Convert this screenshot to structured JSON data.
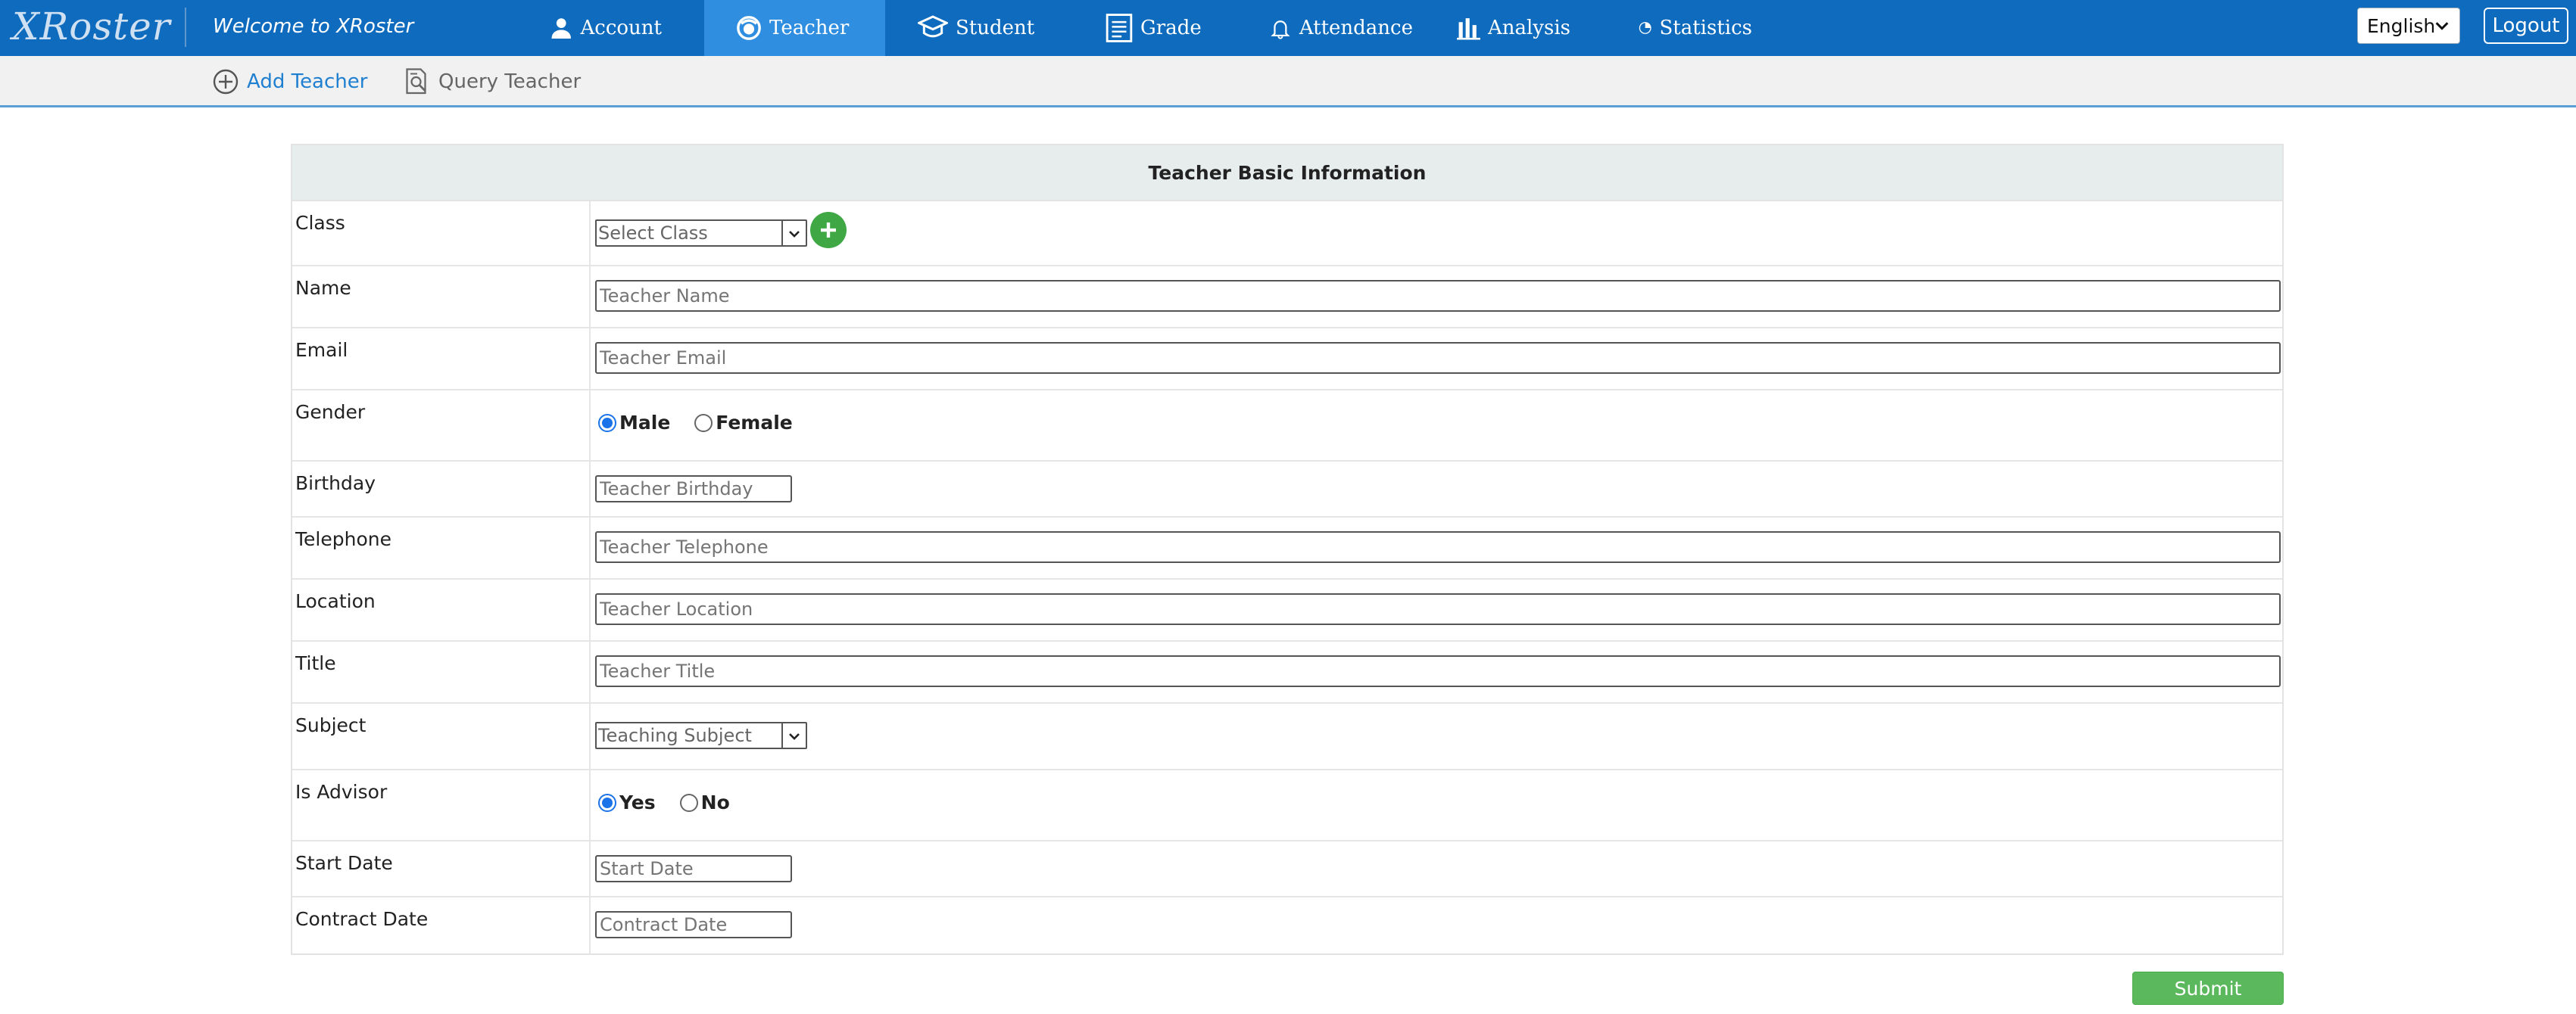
{
  "app": {
    "logo_text": "XRoster",
    "welcome_text": "Welcome to XRoster",
    "brand_color": "#0e6bbd",
    "active_color": "#2f8ee0"
  },
  "nav": {
    "items": [
      {
        "label": "Account",
        "icon": "user-icon",
        "active": false
      },
      {
        "label": "Teacher",
        "icon": "teacher-icon",
        "active": true
      },
      {
        "label": "Student",
        "icon": "student-cap-icon",
        "active": false
      },
      {
        "label": "Grade",
        "icon": "list-icon",
        "active": false
      },
      {
        "label": "Attendance",
        "icon": "bell-icon",
        "active": false
      },
      {
        "label": "Analysis",
        "icon": "bar-chart-icon",
        "active": false
      },
      {
        "label": "Statistics",
        "icon": "pie-chart-icon",
        "active": false
      }
    ],
    "language": "English",
    "logout_label": "Logout"
  },
  "subnav": {
    "add_label": "Add Teacher",
    "add_icon": "plus-circle-icon",
    "query_label": "Query Teacher",
    "query_icon": "search-document-icon"
  },
  "form": {
    "title": "Teacher Basic Information",
    "class": {
      "label": "Class",
      "placeholder": "Select Class",
      "add_icon": "add-circle-icon"
    },
    "name": {
      "label": "Name",
      "placeholder": "Teacher Name",
      "value": ""
    },
    "email": {
      "label": "Email",
      "placeholder": "Teacher Email",
      "value": ""
    },
    "gender": {
      "label": "Gender",
      "options": [
        "Male",
        "Female"
      ],
      "selected": "Male"
    },
    "birthday": {
      "label": "Birthday",
      "placeholder": "Teacher Birthday",
      "value": ""
    },
    "telephone": {
      "label": "Telephone",
      "placeholder": "Teacher Telephone",
      "value": ""
    },
    "location": {
      "label": "Location",
      "placeholder": "Teacher Location",
      "value": ""
    },
    "title_field": {
      "label": "Title",
      "placeholder": "Teacher Title",
      "value": ""
    },
    "subject": {
      "label": "Subject",
      "placeholder": "Teaching Subject"
    },
    "is_advisor": {
      "label": "Is Advisor",
      "options": [
        "Yes",
        "No"
      ],
      "selected": "Yes"
    },
    "start_date": {
      "label": "Start Date",
      "placeholder": "Start Date",
      "value": ""
    },
    "contract_date": {
      "label": "Contract Date",
      "placeholder": "Contract Date",
      "value": ""
    },
    "submit_label": "Submit",
    "submit_color": "#5cb85c"
  }
}
